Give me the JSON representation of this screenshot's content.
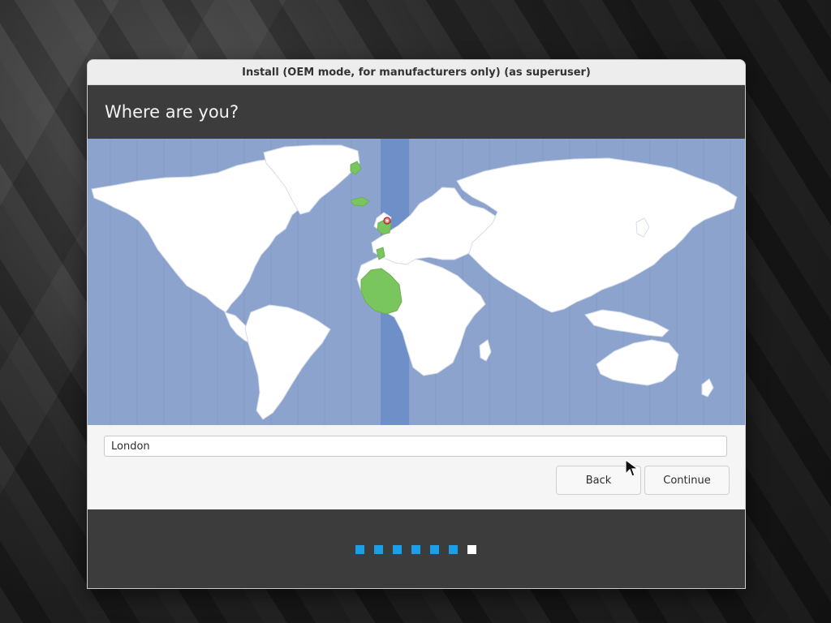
{
  "window": {
    "title": "Install (OEM mode, for manufacturers only) (as superuser)"
  },
  "header": {
    "title": "Where are you?"
  },
  "map": {
    "selected_city": "London",
    "selected_timezone_highlight": "#79c55e",
    "timezone_band_color": "#6f8fc8"
  },
  "location": {
    "value": "London"
  },
  "buttons": {
    "back": "Back",
    "continue": "Continue"
  },
  "progress": {
    "current_step": 7,
    "total_steps": 7
  },
  "colors": {
    "accent": "#1c9fe6",
    "header_bg": "#3c3c3c",
    "map_ocean": "#8ba3cd"
  }
}
